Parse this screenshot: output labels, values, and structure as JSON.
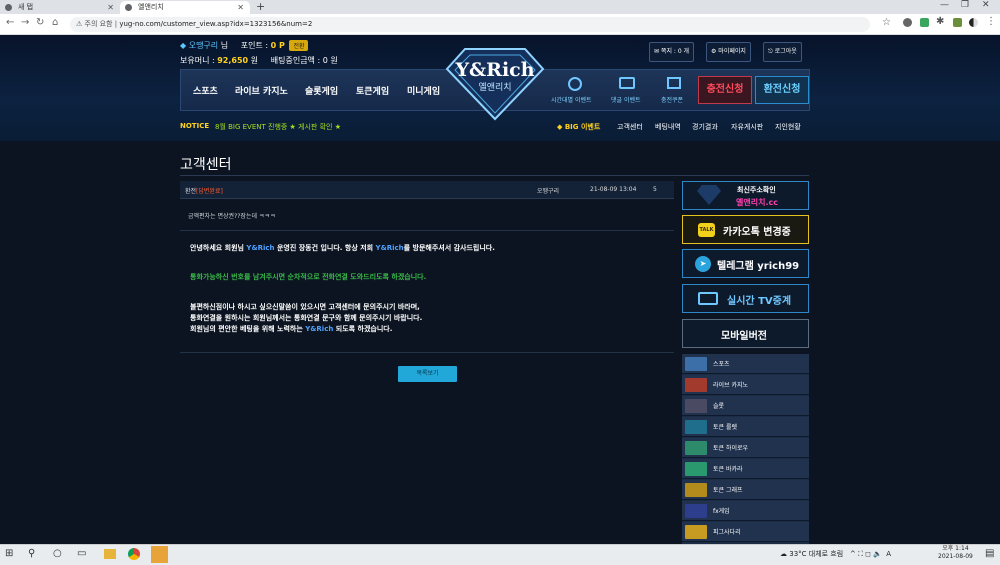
{
  "browser": {
    "tabs": [
      {
        "label": "새 탭"
      },
      {
        "label": "옐앤리치"
      }
    ],
    "new_tab": "+",
    "security": "주의 요함",
    "url": "yug-no.com/customer_view.asp?idx=1323156&num=2"
  },
  "header": {
    "user_name": "오땡구리",
    "user_suffix": "님",
    "points_label": "포인트 :",
    "points_value": "0 P",
    "convert_label": "전환",
    "money_label": "보유머니 :",
    "money_value": "92,650",
    "money_unit": "원",
    "bet_label": "배팅중인금액 : 0 원",
    "top_buttons": [
      "쪽지 : 0 개",
      "마이페이지",
      "로그아웃"
    ],
    "logo_text": "Y&Rich",
    "logo_sub": "옐앤리치",
    "nav": [
      "스포츠",
      "라이브 카지노",
      "슬롯게임",
      "토큰게임",
      "미니게임"
    ],
    "events": [
      "시간대별 이벤트",
      "댓글 이벤트",
      "충전쿠폰"
    ],
    "charge": "충전신청",
    "withdraw": "환전신청",
    "notice_label": "NOTICE",
    "notice_text": "8월 BIG EVENT 진행중 ★ 게시판 확인 ★",
    "sub_links": [
      "BIG 이벤트",
      "고객센터",
      "베팅내역",
      "경기결과",
      "자유게시판",
      "지인현황"
    ]
  },
  "content": {
    "title": "고객센터",
    "post": {
      "category": "환전",
      "status": "[답변완료]",
      "author": "오땡구리",
      "date": "21-08-09 13:04",
      "count": "5",
      "question": "금액편차는 면상권??잠는데 ㅋㅋㅋ",
      "greeting_a": "안녕하세요 회원님 ",
      "greeting_brand": "Y&Rich",
      "greeting_b": " 운영진 장동건 입니다.  항상 저희 ",
      "greeting_brand2": "Y&Rich",
      "greeting_c": "를 방문해주셔서 감사드립니다.",
      "green_line": "통화가능하신 번호를 남겨주시면 순차적으로 전화연결 도와드리도록 하겠습니다.",
      "closing_1": "불편하신점이나 하시고 싶으신말씀이 있으시면 고객센터에 문의주시기 바라며,",
      "closing_2": "통화연결을 원하시는 회원님께서는 통화연결 문구와 함께 문의주시기 바랍니다.",
      "closing_3a": "회원님의 편안한 베팅을 위해 노력하는 ",
      "closing_3b": "Y&Rich",
      "closing_3c": " 되도록 하겠습니다.",
      "list_button": "목록보기"
    }
  },
  "sidebar": {
    "domain_title": "최신주소확인",
    "domain_value": "옐앤리치.cc",
    "kakao": "카카오톡 변경중",
    "kakao_badge": "TALK",
    "telegram": "텔레그램  yrich99",
    "tv": "실시간 TV중계",
    "mobile": "모바일버전",
    "games": [
      {
        "label": "스포츠",
        "color": "#3c6fa8"
      },
      {
        "label": "라이브 카지노",
        "color": "#a33a2e"
      },
      {
        "label": "슬롯",
        "color": "#4a4a62"
      },
      {
        "label": "토큰 룰렛",
        "color": "#1f6e8c"
      },
      {
        "label": "토큰 하이로우",
        "color": "#2d8a6a"
      },
      {
        "label": "토큰 바카라",
        "color": "#2a9a6e"
      },
      {
        "label": "토큰 그래프",
        "color": "#b38a1c"
      },
      {
        "label": "fx게임",
        "color": "#2c3e8c"
      },
      {
        "label": "피그사다리",
        "color": "#c79a22"
      }
    ]
  },
  "taskbar": {
    "weather": "33°C  대체로 흐림",
    "ime": "A",
    "time": "오후 1:14",
    "date": "2021-08-09"
  },
  "colors": {
    "accent": "#21a8d8",
    "gold": "#ffd21f",
    "brand_blue": "#4fa2ff"
  }
}
